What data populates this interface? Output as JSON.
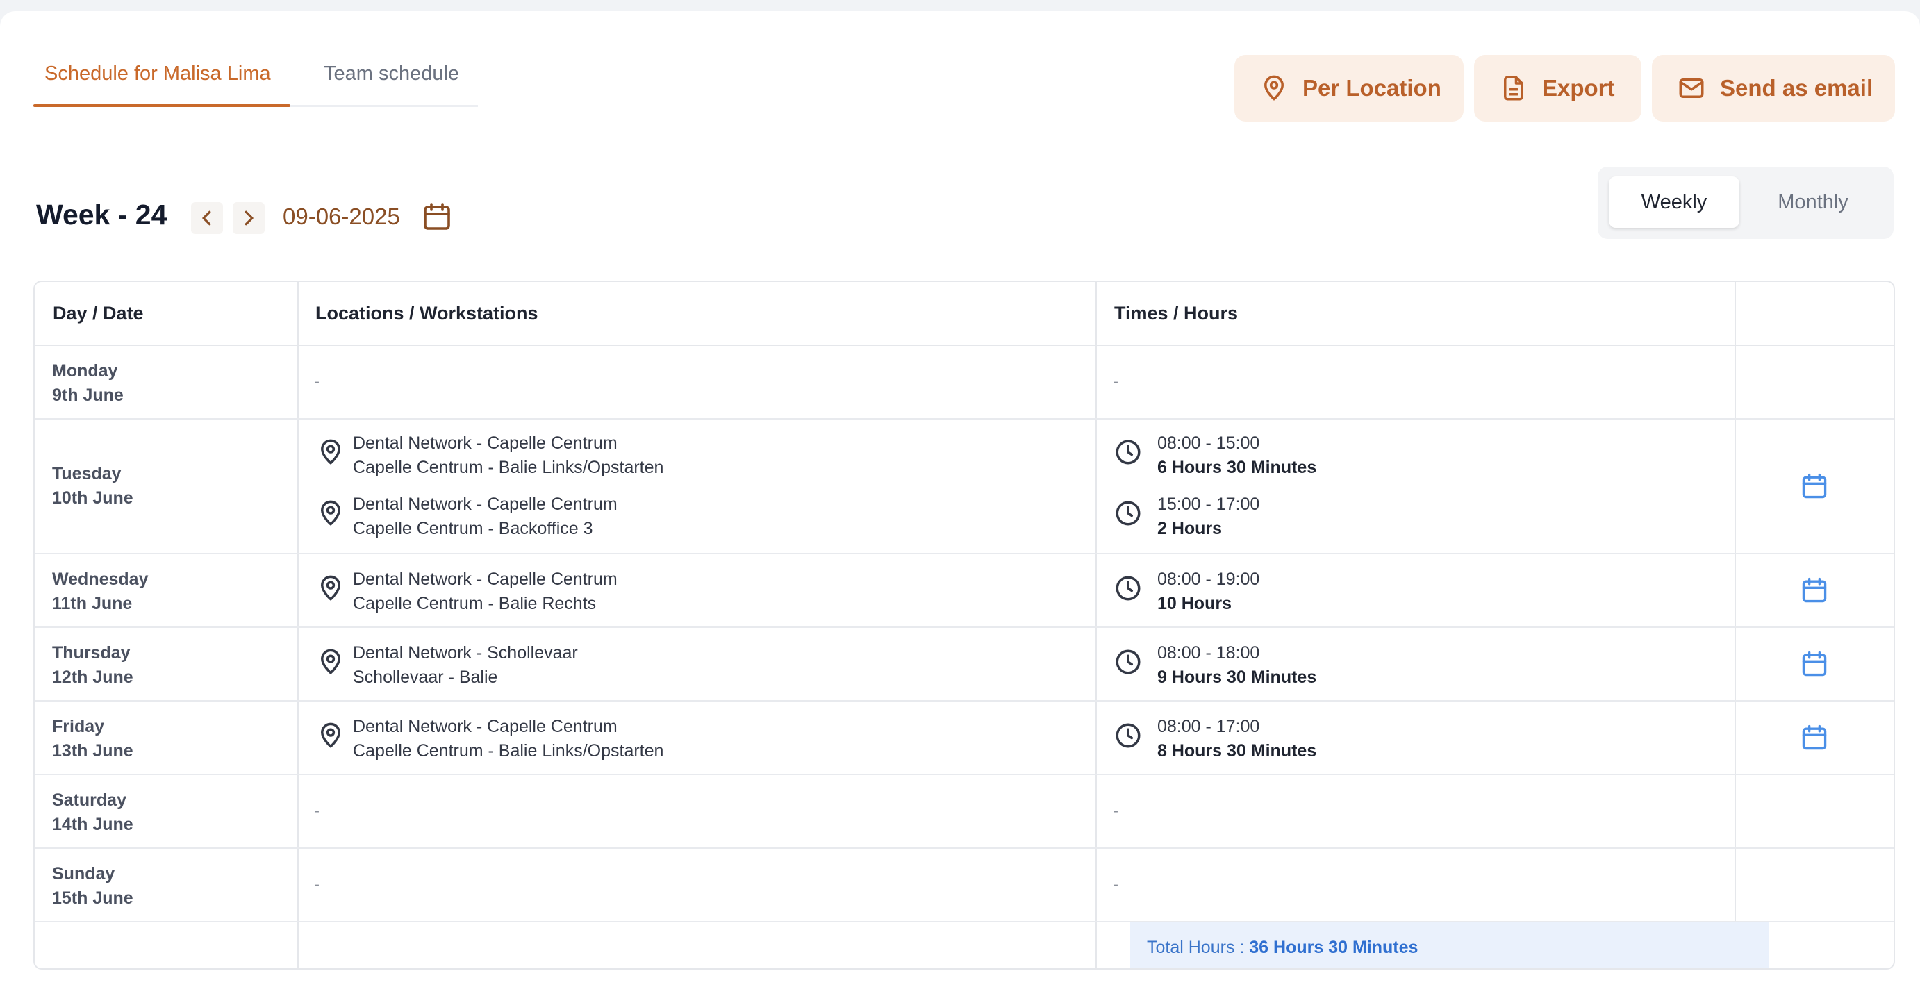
{
  "tabs": [
    {
      "label": "Schedule for Malisa Lima",
      "active": true
    },
    {
      "label": "Team schedule",
      "active": false
    }
  ],
  "actions": {
    "per_location": "Per Location",
    "export": "Export",
    "send_email": "Send as email"
  },
  "week": {
    "title": "Week - 24",
    "date": "09-06-2025"
  },
  "view_toggle": {
    "weekly": "Weekly",
    "monthly": "Monthly",
    "selected": "Weekly"
  },
  "table": {
    "headers": {
      "day_date": "Day / Date",
      "locations": "Locations / Workstations",
      "times": "Times / Hours",
      "actions": ""
    },
    "rows": [
      {
        "day": "Monday",
        "date": "9th June",
        "empty": "-",
        "entries": []
      },
      {
        "day": "Tuesday",
        "date": "10th June",
        "entries": [
          {
            "location": "Dental Network - Capelle Centrum",
            "workstation": "Capelle Centrum - Balie Links/Opstarten",
            "time": "08:00 - 15:00",
            "hours": "6 Hours 30 Minutes"
          },
          {
            "location": "Dental Network - Capelle Centrum",
            "workstation": "Capelle Centrum - Backoffice 3",
            "time": "15:00 - 17:00",
            "hours": "2 Hours"
          }
        ]
      },
      {
        "day": "Wednesday",
        "date": "11th June",
        "entries": [
          {
            "location": "Dental Network - Capelle Centrum",
            "workstation": "Capelle Centrum - Balie Rechts",
            "time": "08:00 - 19:00",
            "hours": "10 Hours"
          }
        ]
      },
      {
        "day": "Thursday",
        "date": "12th June",
        "entries": [
          {
            "location": "Dental Network - Schollevaar",
            "workstation": "Schollevaar - Balie",
            "time": "08:00 - 18:00",
            "hours": "9 Hours 30 Minutes"
          }
        ]
      },
      {
        "day": "Friday",
        "date": "13th June",
        "entries": [
          {
            "location": "Dental Network - Capelle Centrum",
            "workstation": "Capelle Centrum - Balie Links/Opstarten",
            "time": "08:00 - 17:00",
            "hours": "8 Hours 30 Minutes"
          }
        ]
      },
      {
        "day": "Saturday",
        "date": "14th June",
        "empty": "-",
        "entries": []
      },
      {
        "day": "Sunday",
        "date": "15th June",
        "empty": "-",
        "entries": []
      }
    ],
    "total": {
      "label": "Total Hours : ",
      "value": "36 Hours 30 Minutes"
    }
  },
  "icons": {
    "location": "map-pin-icon",
    "export": "document-icon",
    "email": "mail-icon",
    "clock": "clock-icon",
    "calendar": "calendar-icon"
  },
  "colors": {
    "accent": "#c9692a",
    "button_bg": "#fbefe6",
    "calendar_blue": "#4a8fe7",
    "total_bg": "#eaf1fc",
    "total_text": "#2f6fd0"
  }
}
